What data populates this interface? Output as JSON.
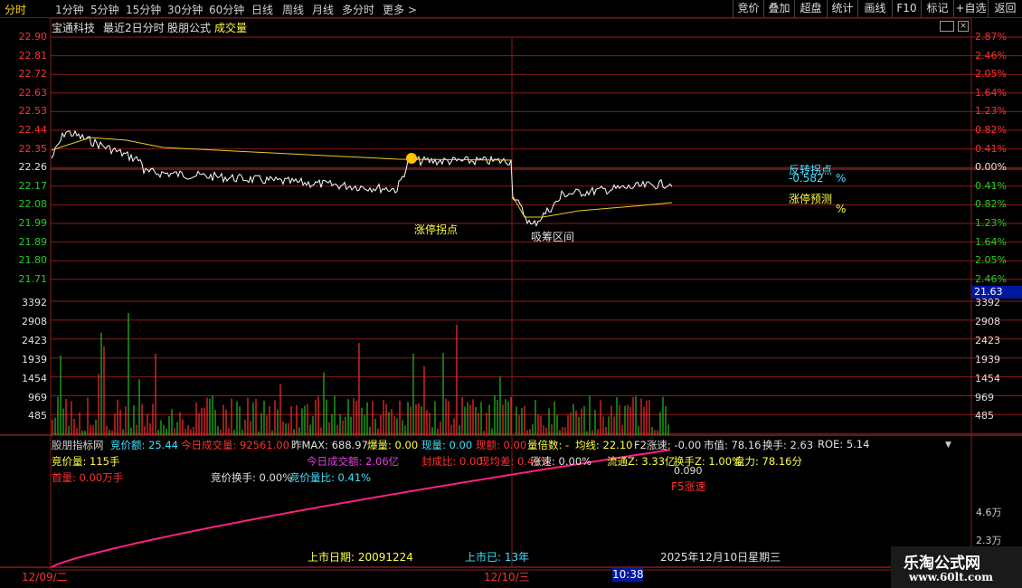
{
  "topbar": {
    "periods": [
      "分时",
      "1分钟",
      "5分钟",
      "15分钟",
      "30分钟",
      "60分钟",
      "日线",
      "周线",
      "月线",
      "多分时",
      "更多 >"
    ],
    "active_period": "分时",
    "buttons": [
      "竞价",
      "叠加",
      "超盘",
      "统计",
      "画线",
      "F10",
      "标记",
      "+自选",
      "返回"
    ]
  },
  "header": {
    "stock_name": "宝通科技",
    "mode": "最近2日分时",
    "formula": "股朋公式",
    "volume_label": "成交量"
  },
  "price_axis_left": [
    "22.90",
    "22.81",
    "22.72",
    "22.63",
    "22.53",
    "22.44",
    "22.35",
    "22.26",
    "22.17",
    "22.08",
    "21.99",
    "21.89",
    "21.80",
    "21.71"
  ],
  "price_axis_right": [
    "2.87%",
    "2.46%",
    "2.05%",
    "1.64%",
    "1.23%",
    "0.82%",
    "0.41%",
    "0.00%",
    "0.41%",
    "0.82%",
    "1.23%",
    "1.64%",
    "2.05%",
    "2.46%"
  ],
  "current_price_tag": "21.63",
  "volume_axis": [
    "3392",
    "2908",
    "2423",
    "1939",
    "1454",
    "969",
    "485"
  ],
  "annotations": {
    "limit_up_turn": "涨停拐点",
    "accumulate_zone": "吸筹区间",
    "reverse_point_label": "反转拐点",
    "reverse_point_value": "-0.582",
    "reverse_point_unit": "%",
    "limit_predict_label": "涨停预测",
    "limit_predict_unit": "%"
  },
  "indicator": {
    "row1": [
      {
        "text": "股朋指标网",
        "color": "#d0d0d0"
      },
      {
        "text": "竞价额: 25.44",
        "color": "#40e0ff"
      },
      {
        "text": "今日成交量: 92561.00",
        "color": "#ff3030"
      },
      {
        "text": "昨MAX: 688.97",
        "color": "#e0e0e0"
      },
      {
        "text": "爆量: 0.00",
        "color": "#ffff40"
      },
      {
        "text": "现量: 0.00",
        "color": "#40e0ff"
      },
      {
        "text": "现额: 0.00",
        "color": "#ff3030"
      },
      {
        "text": "量倍数: -",
        "color": "#ffff40"
      },
      {
        "text": "均线: 22.10",
        "color": "#ffff40"
      },
      {
        "text": "F2涨速: -0.00",
        "color": "#e0e0e0"
      },
      {
        "text": "市值: 78.16",
        "color": "#e0e0e0"
      },
      {
        "text": "换手: 2.63",
        "color": "#e0e0e0"
      },
      {
        "text": "ROE: 5.14",
        "color": "#e0e0e0"
      }
    ],
    "row2": [
      {
        "text": "竞价量: 115手",
        "color": "#ffff40"
      },
      {
        "text": "今日成交额: 2.06亿",
        "color": "#e040e0"
      },
      {
        "text": "封成比: 0.00",
        "color": "#ff3030"
      },
      {
        "text": "现均差: 0.49%",
        "color": "#ff3030"
      },
      {
        "text": "涨速: 0.00%",
        "color": "#e0e0e0"
      },
      {
        "text": "流通Z: 3.33亿",
        "color": "#ffff40"
      },
      {
        "text": "换手Z: 1.00%",
        "color": "#ffff40"
      },
      {
        "text": "盘力: 78.16分",
        "color": "#ffff40"
      }
    ],
    "row3": [
      {
        "text": "首量: 0.00万手",
        "color": "#ff3030"
      },
      {
        "text": "竞价换手: 0.00%",
        "color": "#e0e0e0"
      },
      {
        "text": "竞价量比: 0.41%",
        "color": "#40e0ff"
      }
    ],
    "f5_value": "0.090",
    "f5_label": "F5涨速",
    "axis": [
      "4.6万",
      "2.3万"
    ],
    "listing_date": "上市日期: 20091224",
    "listed_years": "上市已: 13年",
    "today": "2025年12月10日星期三"
  },
  "time_axis": {
    "day1": "12/09/二",
    "day2": "12/10/三",
    "cursor_time": "10:38"
  },
  "watermark": {
    "title": "乐淘公式网",
    "url": "www.60lt.com"
  },
  "colors": {
    "grid_red": "#8b1a1a",
    "price_line": "#ffffff",
    "avg_line": "#e8d020",
    "up_bar": "#ff3030",
    "down_bar": "#20c020",
    "pink_line": "#ff2080"
  }
}
